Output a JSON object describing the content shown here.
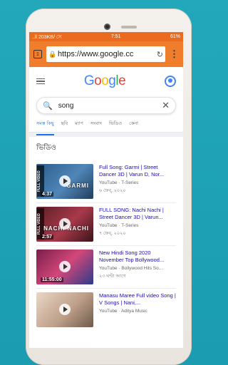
{
  "status": {
    "carrier": "..ll 203KB/ সে",
    "time": "7:51",
    "battery": "61%"
  },
  "browser": {
    "tab_count": "1",
    "url": "https://www.google.cc"
  },
  "google": {
    "logo": "Google",
    "query": "song"
  },
  "tabs": [
    {
      "label": "সমস্ত কিছু",
      "active": true
    },
    {
      "label": "ছবি"
    },
    {
      "label": "ম্যাপ"
    },
    {
      "label": "সংবাদ"
    },
    {
      "label": "ভিডিও"
    },
    {
      "label": "কেনা"
    }
  ],
  "videos": {
    "heading": "ভিডিও",
    "items": [
      {
        "title": "Full Song: Garmi | Street Dancer 3D | Varun D, Nor...",
        "source": "YouTube · T-Series",
        "date": "৬ ফেব্, ২০২০",
        "duration": "4:37",
        "overlay": "GARMI",
        "tag": "FULL VIDEO",
        "thumb_color": "#3b6f9e"
      },
      {
        "title": "FULL SONG: Nachi Nachi | Street Dancer 3D | Varun...",
        "source": "YouTube · T-Series",
        "date": "৭ ফেব্, ২০২০",
        "duration": "2:57",
        "overlay": "NACHI NACHI",
        "tag": "FULL VIDEO",
        "thumb_color": "#8a2f3c"
      },
      {
        "title": "New Hindi Song 2020 November Top Bollywood...",
        "source": "YouTube · Bollywood Hits So...",
        "date": "২৩ ঘণ্টা আগে",
        "duration": "11:55:00",
        "overlay": "",
        "tag": "",
        "thumb_color": "#c43a66"
      },
      {
        "title": "Manasu Maree Full video Song | V Songs | Nani,...",
        "source": "YouTube · Aditya Music",
        "date": "",
        "duration": "",
        "overlay": "",
        "tag": "",
        "thumb_color": "#d9c3b0"
      }
    ]
  }
}
